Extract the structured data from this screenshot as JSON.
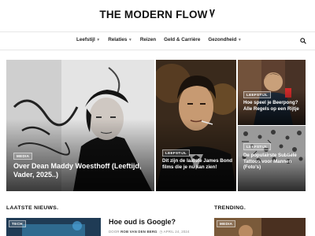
{
  "site": {
    "title": "THE MODERN FLOW"
  },
  "nav": {
    "items": [
      {
        "label": "Leefstijl",
        "has_menu": true
      },
      {
        "label": "Relaties",
        "has_menu": true
      },
      {
        "label": "Reizen",
        "has_menu": false
      },
      {
        "label": "Geld & Carrière",
        "has_menu": false
      },
      {
        "label": "Gezondheid",
        "has_menu": true
      }
    ],
    "search_icon": "search-icon"
  },
  "hero": {
    "main": {
      "category": "Media",
      "title": "Over Dean Maddy Woesthoff (Leeftijd, Vader, 2025..)"
    },
    "middle": {
      "category": "Leefstijl",
      "title": "Dit zijn de laatste James Bond films die je nú kan zien!"
    },
    "top_right": {
      "category": "Leefstijl",
      "title": "Hoe speel je Beerpong? Alle Regels op een Rijtje"
    },
    "bottom_right": {
      "category": "Leefstijl",
      "title": "De populairste Subtiele Tattoos voor Mannen (Foto's)"
    }
  },
  "sections": {
    "latest": {
      "label": "LAATSTE NIEUWS",
      "dot": "."
    },
    "trending": {
      "label": "TRENDING",
      "dot": "."
    }
  },
  "latest_article": {
    "category": "Tech",
    "title": "Hoe oud is Google?",
    "author_prefix": "Door",
    "author": "Rob van den Berg",
    "date": "April 24, 2024"
  },
  "trending_article": {
    "category": "Media"
  },
  "colors": {
    "accent": "#111111",
    "border": "#e6e6e6"
  }
}
